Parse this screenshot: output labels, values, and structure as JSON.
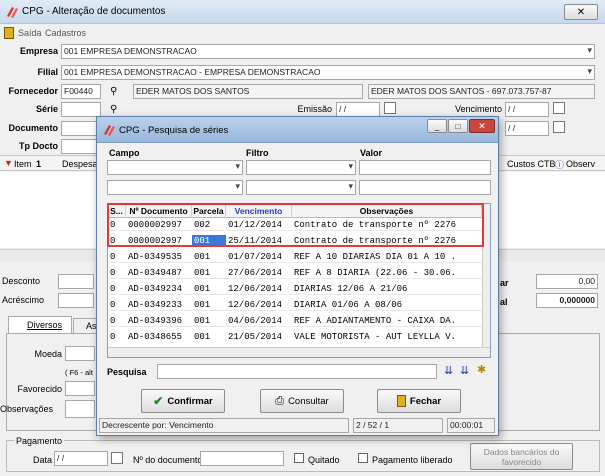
{
  "window": {
    "title": "CPG - Alteração de documentos",
    "close_glyph": "✕"
  },
  "menu": {
    "items": [
      "Saída",
      "Cadastros"
    ]
  },
  "form": {
    "empresa_label": "Empresa",
    "empresa_value": "001 EMPRESA DEMONSTRACAO",
    "filial_label": "Filial",
    "filial_value": "001 EMPRESA DEMONSTRACAO - EMPRESA DEMONSTRACAO",
    "fornecedor_label": "Fornecedor",
    "fornecedor_code": "F00440",
    "fornecedor_name": "EDER MATOS DOS SANTOS",
    "fornecedor_full": "EDER MATOS DOS SANTOS - 697.073.757-87",
    "serie_label": "Série",
    "documento_label": "Documento",
    "tpdocto_label": "Tp Docto",
    "emissao_label": "Emissão",
    "emissao_value": "/ /",
    "vencimento_label": "Vencimento",
    "vencimento_value": "/ /",
    "doc_date_value": "/ /"
  },
  "items_bar": {
    "item_label": "Item",
    "item_num": "1",
    "despesa_label": "Despesa",
    "custos_label": "Custos CTB",
    "observ_label": "Observ"
  },
  "totals": {
    "desconto_label": "Desconto",
    "acrescimo_label": "Acréscimo",
    "val1": "0,00",
    "total_label": "al",
    "val2": "0,000000"
  },
  "tabs": {
    "diversos": "Diversos",
    "as": "As"
  },
  "lower": {
    "moeda_label": "Moeda",
    "f6_hint": "( F6 - alt",
    "favorecido_label": "Favorecido",
    "observacoes_label": "Observações"
  },
  "pagamento": {
    "legend": "Pagamento",
    "data_label": "Data",
    "data_value": "/ /",
    "ndoc_label": "Nº do documento",
    "quitado_label": "Quitado",
    "liberado_label": "Pagamento liberado",
    "dados_btn": "Dados bancários do favorecido"
  },
  "modal": {
    "title": "CPG - Pesquisa de séries",
    "campo_label": "Campo",
    "filtro_label": "Filtro",
    "valor_label": "Valor",
    "columns": [
      "S...",
      "Nº Documento",
      "Parcela",
      "Vencimento",
      "Observações"
    ],
    "rows": [
      [
        "0",
        "0000002997",
        "002",
        "01/12/2014",
        "Contrato de transporte nº 2276"
      ],
      [
        "0",
        "0000002997",
        "001",
        "25/11/2014",
        "Contrato de transporte nº 2276"
      ],
      [
        "0",
        "AD-0349535",
        "001",
        "01/07/2014",
        "REF A 10 DIARIAS DIA 01 A 10 ."
      ],
      [
        "0",
        "AD-0349487",
        "001",
        "27/06/2014",
        "REF A 8 DIARIA (22.06 - 30.06."
      ],
      [
        "0",
        "AD-0349234",
        "001",
        "12/06/2014",
        "DIARIAS 12/06 A 21/06"
      ],
      [
        "0",
        "AD-0349233",
        "001",
        "12/06/2014",
        "DIARIA 01/06 A 08/06"
      ],
      [
        "0",
        "AD-0349396",
        "001",
        "04/06/2014",
        "REF A ADIANTAMENTO - CAIXA DA."
      ],
      [
        "0",
        "AD-0348655",
        "001",
        "21/05/2014",
        "VALE MOTORISTA - AUT LEYLLA V."
      ]
    ],
    "pesquisa_label": "Pesquisa",
    "confirmar": "Confirmar",
    "consultar": "Consultar",
    "fechar": "Fechar",
    "status_sort": "Decrescente por: Vencimento",
    "status_count": "2 / 52 / 1",
    "status_time": "00:00:01",
    "vencimento_color": "#1f3fbf",
    "highlight_color": "#e53935"
  }
}
